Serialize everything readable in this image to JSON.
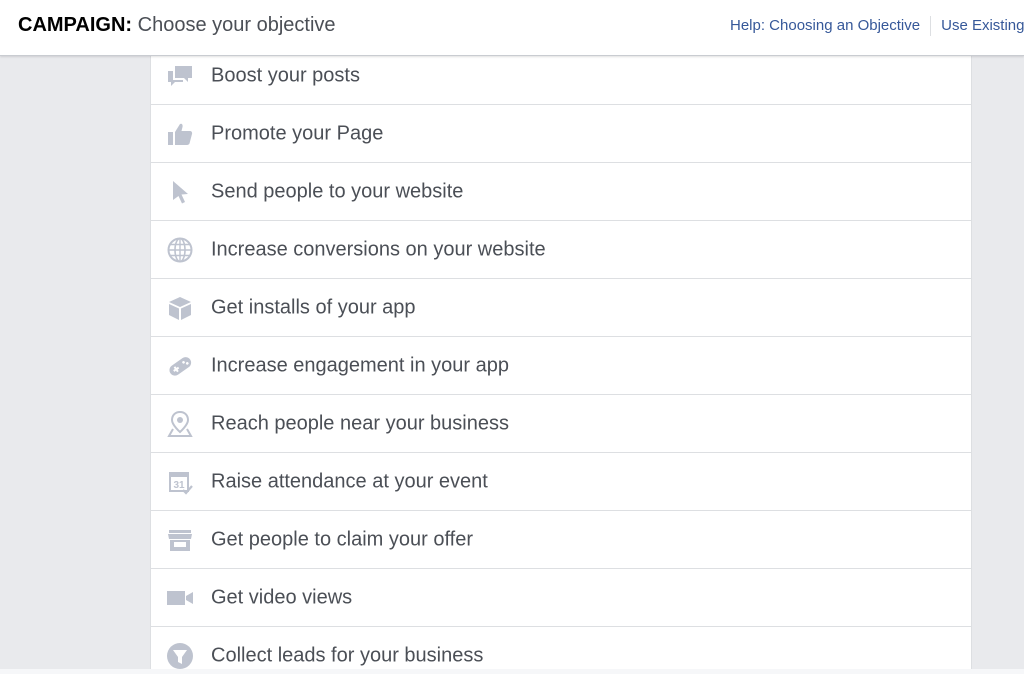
{
  "header": {
    "label": "CAMPAIGN:",
    "title": "Choose your objective",
    "help_link": "Help: Choosing an Objective",
    "existing_link": "Use Existing"
  },
  "colors": {
    "icon": "#bec3cf",
    "text": "#4b4f56",
    "link": "#365899",
    "background": "#e9eaed"
  },
  "objectives": [
    {
      "label": "Boost your posts",
      "icon": "chat-bubbles-icon"
    },
    {
      "label": "Promote your Page",
      "icon": "thumbs-up-icon"
    },
    {
      "label": "Send people to your website",
      "icon": "cursor-icon"
    },
    {
      "label": "Increase conversions on your website",
      "icon": "globe-icon"
    },
    {
      "label": "Get installs of your app",
      "icon": "box-icon"
    },
    {
      "label": "Increase engagement in your app",
      "icon": "gamepad-icon"
    },
    {
      "label": "Reach people near your business",
      "icon": "map-pin-icon"
    },
    {
      "label": "Raise attendance at your event",
      "icon": "calendar-icon"
    },
    {
      "label": "Get people to claim your offer",
      "icon": "store-icon"
    },
    {
      "label": "Get video views",
      "icon": "video-camera-icon"
    },
    {
      "label": "Collect leads for your business",
      "icon": "funnel-icon"
    }
  ],
  "calendar_day": "31"
}
